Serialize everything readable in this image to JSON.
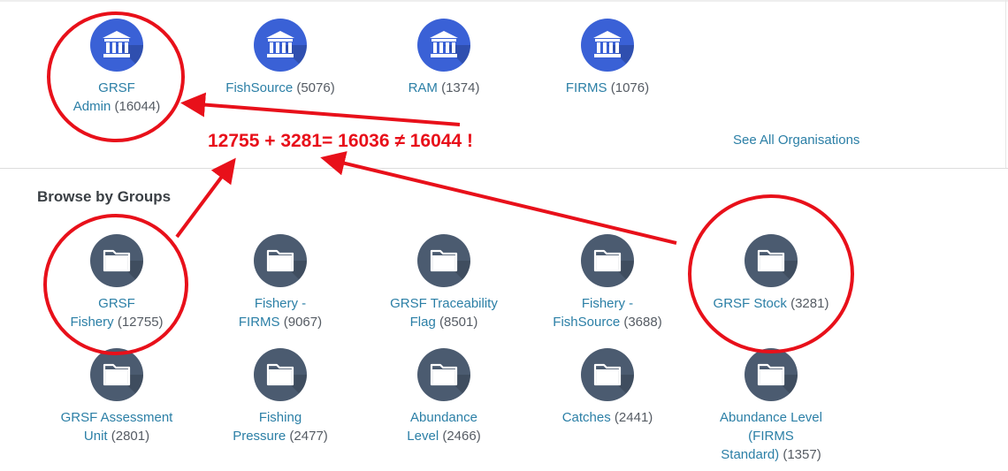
{
  "organisations": [
    {
      "name_line1": "GRSF",
      "name_line2": "Admin",
      "count": "(16044)",
      "icon": "bank-icon"
    },
    {
      "name_line1": "FishSource",
      "name_line2": "",
      "count": "(5076)",
      "icon": "bank-icon"
    },
    {
      "name_line1": "RAM",
      "name_line2": "",
      "count": "(1374)",
      "icon": "bank-icon"
    },
    {
      "name_line1": "FIRMS",
      "name_line2": "",
      "count": "(1076)",
      "icon": "bank-icon"
    }
  ],
  "see_all_label": "See All Organisations",
  "groups_heading": "Browse by Groups",
  "groups": [
    {
      "name_line1": "GRSF",
      "name_line2": "Fishery",
      "count": "(12755)",
      "icon": "folder-icon"
    },
    {
      "name_line1": "Fishery -",
      "name_line2": "FIRMS",
      "count": "(9067)",
      "icon": "folder-icon"
    },
    {
      "name_line1": "GRSF Traceability",
      "name_line2": "Flag",
      "count": "(8501)",
      "icon": "folder-icon"
    },
    {
      "name_line1": "Fishery -",
      "name_line2": "FishSource",
      "count": "(3688)",
      "icon": "folder-icon"
    },
    {
      "name_line1": "GRSF Stock",
      "name_line2": "",
      "count": "(3281)",
      "icon": "folder-icon"
    },
    {
      "name_line1": "GRSF Assessment",
      "name_line2": "Unit",
      "count": "(2801)",
      "icon": "folder-icon"
    },
    {
      "name_line1": "Fishing",
      "name_line2": "Pressure",
      "count": "(2477)",
      "icon": "folder-icon"
    },
    {
      "name_line1": "Abundance",
      "name_line2": "Level",
      "count": "(2466)",
      "icon": "folder-icon"
    },
    {
      "name_line1": "Catches",
      "name_line2": "",
      "count": "(2441)",
      "icon": "folder-icon"
    },
    {
      "name_line1": "Abundance Level",
      "name_line2": "(FIRMS",
      "name_line3": "Standard)",
      "count": "(1357)",
      "icon": "folder-icon"
    }
  ],
  "annotation": {
    "text": "12755 + 3281= 16036 ≠ 16044 !",
    "color": "#e8101a"
  },
  "colors": {
    "link": "#2b7fa6",
    "count": "#555b63",
    "org_circle": "#3a61d6",
    "group_circle": "#4b5b70"
  }
}
